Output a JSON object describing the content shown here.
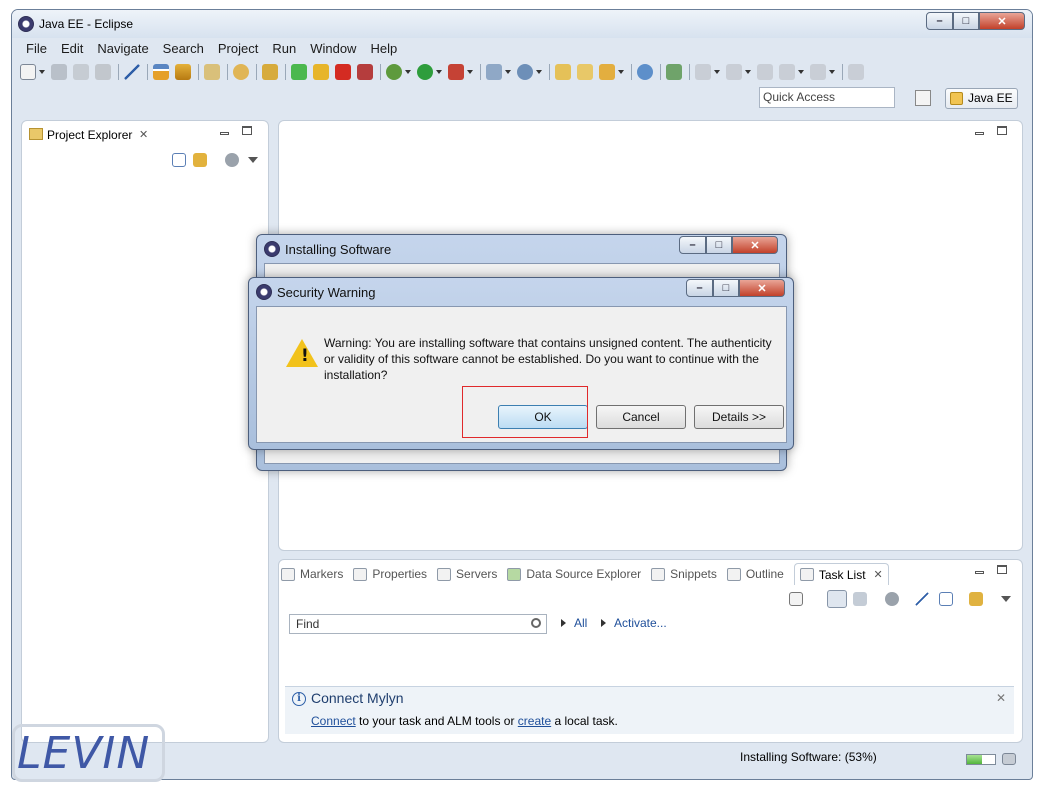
{
  "window": {
    "title": "Java EE - Eclipse",
    "controls": [
      "–",
      "□",
      "✕"
    ]
  },
  "menu": [
    "File",
    "Edit",
    "Navigate",
    "Search",
    "Project",
    "Run",
    "Window",
    "Help"
  ],
  "toolbar": {
    "quick_access_placeholder": "Quick Access",
    "perspective": "Java EE"
  },
  "project_explorer": {
    "title": "Project Explorer",
    "close": "✕"
  },
  "tasks_view": {
    "tabs": [
      "Markers",
      "Properties",
      "Servers",
      "Data Source Explorer",
      "Snippets",
      "Outline",
      "Task List"
    ],
    "active_tab": "Task List",
    "find_placeholder": "Find",
    "filter_all": "All",
    "activate": "Activate...",
    "mylyn": {
      "title": "Connect Mylyn",
      "connect_link": "Connect",
      "middle_text": " to your task and ALM tools or ",
      "create_link": "create",
      "end_text": " a local task.",
      "close": "✕"
    }
  },
  "status": {
    "text": "Installing Software: (53%)",
    "progress_percent": 53
  },
  "installing_dialog": {
    "title": "Installing Software"
  },
  "security_dialog": {
    "title": "Security Warning",
    "message": "Warning: You are installing software that contains unsigned content. The authenticity or validity of this software cannot be established. Do you want to continue with the installation?",
    "ok": "OK",
    "cancel": "Cancel",
    "details": "Details >>"
  },
  "watermark": "LEVIN",
  "colors": {
    "highlight": "#e0292b",
    "accent": "#3c7fb1"
  }
}
